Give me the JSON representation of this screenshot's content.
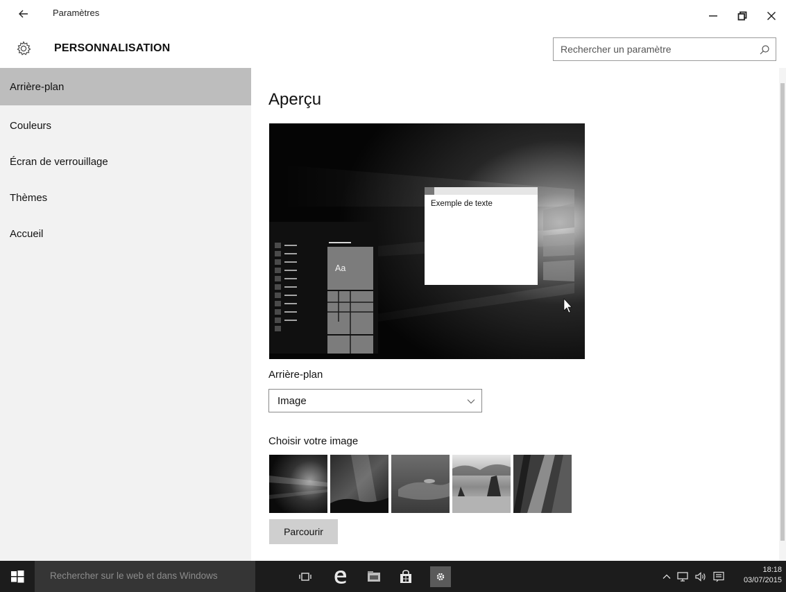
{
  "window": {
    "title": "Paramètres",
    "back_icon": "back-arrow-icon",
    "controls": [
      "minimize-icon",
      "restore-icon",
      "close-icon"
    ]
  },
  "header": {
    "icon": "gear-icon",
    "title": "PERSONNALISATION",
    "search_placeholder": "Rechercher un paramètre",
    "search_icon": "search-icon"
  },
  "sidebar": {
    "active_index": 0,
    "items": [
      {
        "label": "Arrière-plan"
      },
      {
        "label": "Couleurs"
      },
      {
        "label": "Écran de verrouillage"
      },
      {
        "label": "Thèmes"
      },
      {
        "label": "Accueil"
      }
    ]
  },
  "main": {
    "title": "Aperçu",
    "preview": {
      "sample_text": "Exemple de texte",
      "tile_text": "Aa"
    },
    "background_label": "Arrière-plan",
    "background_value": "Image",
    "choose_label": "Choisir votre image",
    "thumbnails": [
      "image-1",
      "image-2",
      "image-3",
      "image-4",
      "image-5"
    ],
    "browse_label": "Parcourir"
  },
  "taskbar": {
    "search_text": "Rechercher sur le web et dans Windows",
    "apps": [
      "task-view-icon",
      "edge-icon",
      "file-explorer-icon",
      "store-icon",
      "settings-icon"
    ],
    "tray": [
      "chevron-up-icon",
      "network-icon",
      "volume-icon",
      "notifications-icon"
    ],
    "time": "18:18",
    "date": "03/07/2015"
  }
}
